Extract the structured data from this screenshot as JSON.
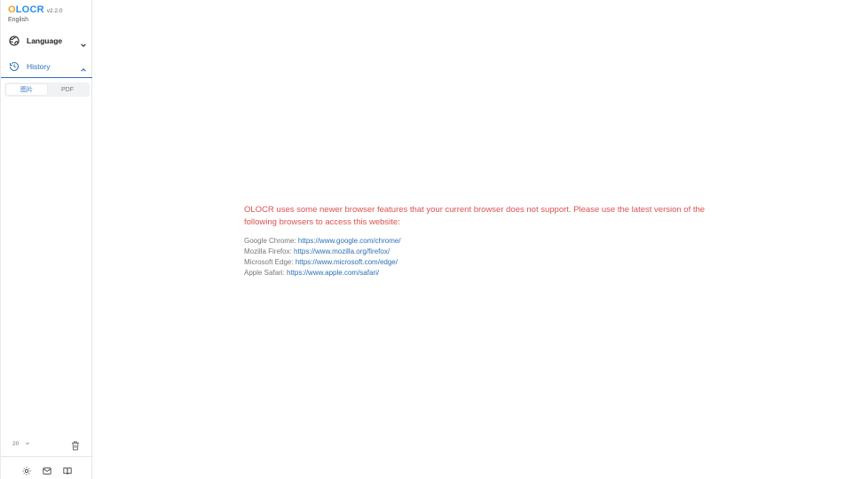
{
  "brand": {
    "logo_first": "O",
    "logo_rest": "LOCR",
    "version": "v2.2.0",
    "language_label": "English"
  },
  "sidebar": {
    "language_item": "Language",
    "history_item": "History",
    "tabs": [
      {
        "label": "图片",
        "active": true
      },
      {
        "label": "PDF",
        "active": false
      }
    ],
    "page_size": "20"
  },
  "icons": {
    "language": "globe-icon",
    "history": "history-icon",
    "trash": "trash-icon",
    "theme": "sun-icon",
    "mail": "mail-icon",
    "docs": "book-icon"
  },
  "colors": {
    "accent": "#2d6fb6",
    "logo_orange": "#f0a020",
    "logo_blue": "#2d8cf0",
    "warning_text": "#d9534f"
  },
  "notice": {
    "message": "OLOCR uses some newer browser features that your current browser does not support. Please use the latest version of the following browsers to access this website:",
    "browsers": [
      {
        "name": "Google Chrome: ",
        "url": "https://www.google.com/chrome/"
      },
      {
        "name": "Mozilla Firefox: ",
        "url": "https://www.mozilla.org/firefox/"
      },
      {
        "name": "Microsoft Edge: ",
        "url": "https://www.microsoft.com/edge/"
      },
      {
        "name": "Apple Safari: ",
        "url": "https://www.apple.com/safari/"
      }
    ]
  }
}
